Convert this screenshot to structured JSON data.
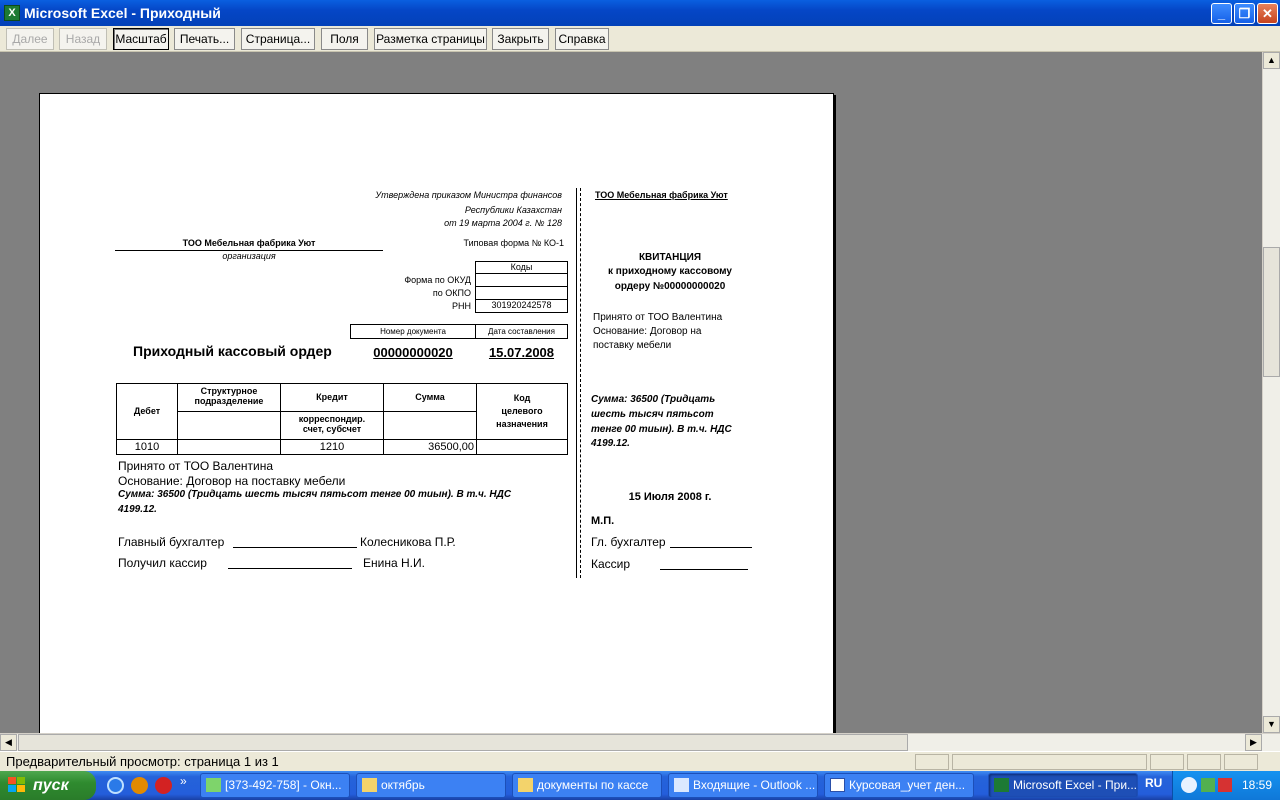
{
  "window": {
    "title": "Microsoft Excel - Приходный",
    "app_icon": "X"
  },
  "toolbar": {
    "next": "Далее",
    "back": "Назад",
    "zoom": "Масштаб",
    "print": "Печать...",
    "setup": "Страница...",
    "margins": "Поля",
    "page_break": "Разметка страницы",
    "close": "Закрыть",
    "help": "Справка"
  },
  "doc": {
    "approved_1": "Утверждена приказом Министра финансов",
    "approved_2": "Республики Казахстан",
    "approved_3": "от  19 марта 2004 г. № 128",
    "org_name": "ТОО Мебельная фабрика Уют",
    "org_caption": "организация",
    "form_type": "Типовая форма № КО-1",
    "codes_header": "Коды",
    "okud_label": "Форма по ОКУД",
    "okpo_label": "по ОКПО",
    "rnn_label": "РНН",
    "rnn_value": "301920242578",
    "docnum_header": "Номер документа",
    "date_header": "Дата составления",
    "order_title": "Приходный кассовый ордер",
    "order_number": "00000000020",
    "order_date": "15.07.2008",
    "table": {
      "debit": "Дебет",
      "subdivision_1": "Структурное",
      "subdivision_2": "подразделение",
      "credit": "Кредит",
      "corr_1": "корреспондир.",
      "corr_2": "счет, субсчет",
      "sum": "Сумма",
      "purpose_1": "Код",
      "purpose_2": "целевого",
      "purpose_3": "назначения",
      "row_debit": "1010",
      "row_subdivision": "",
      "row_corr": "1210",
      "row_sum": "36500,00",
      "row_purpose": ""
    },
    "received_from": "Принято от ТОО Валентина",
    "basis": "Основание: Договор на поставку мебели",
    "sum_text_1": "Сумма: 36500 (Тридцать шесть тысяч пятьсот тенге 00 тиын). В т.ч. НДС",
    "sum_text_2": "4199.12.",
    "chief_accountant_label": "Главный бухгалтер",
    "chief_accountant_name": "Колесникова П.Р.",
    "cashier_label": "Получил кассир",
    "cashier_name": "Енина Н.И."
  },
  "receipt": {
    "org_name": "ТОО Мебельная фабрика Уют",
    "title_1": "КВИТАНЦИЯ",
    "title_2": "к приходному кассовому",
    "title_3": "ордеру №00000000020",
    "received_1": "Принято от ТОО Валентина",
    "received_2": "Основание: Договор на",
    "received_3": "поставку мебели",
    "sum_1": "Сумма: 36500 (Тридцать",
    "sum_2": "шесть тысяч пятьсот",
    "sum_3": "тенге 00 тиын). В т.ч. НДС",
    "sum_4": "4199.12.",
    "date": "15 Июля 2008 г.",
    "stamp": "М.П.",
    "accountant": "Гл. бухгалтер",
    "cashier": "Кассир"
  },
  "status": {
    "text": "Предварительный просмотр: страница 1 из 1"
  },
  "taskbar": {
    "start": "пуск",
    "tasks": [
      "[373-492-758] - Окн...",
      "октябрь",
      "документы по кассе",
      "Входящие - Outlook ...",
      "Курсовая_учет ден...",
      "Microsoft Excel - При..."
    ],
    "lang": "RU",
    "clock": "18:59"
  }
}
